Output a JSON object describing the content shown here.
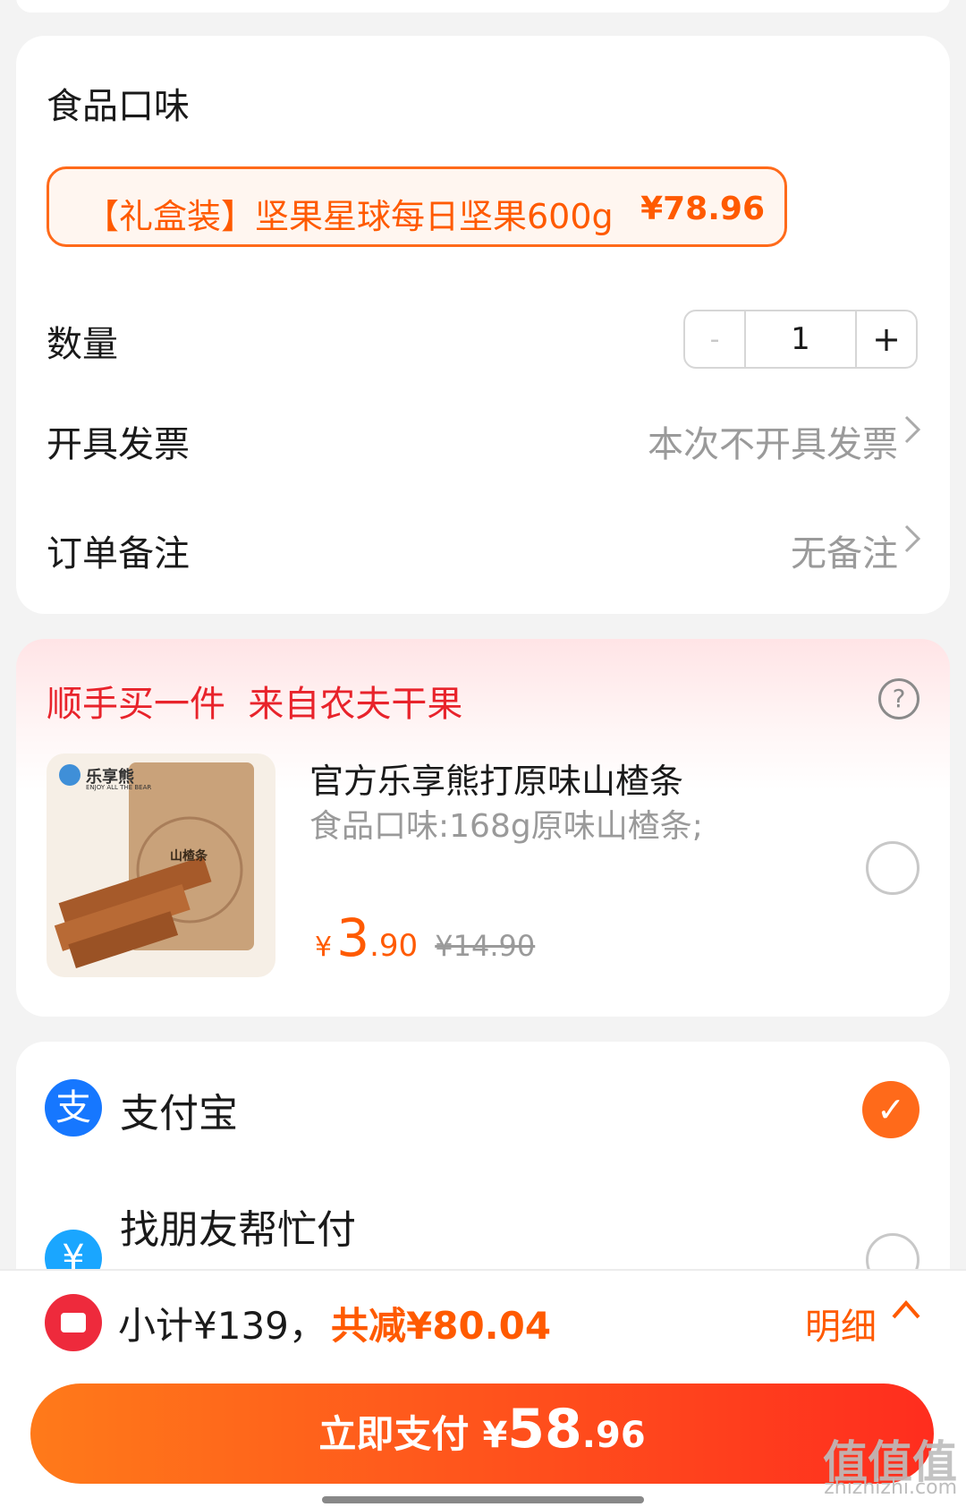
{
  "options": {
    "flavor_label": "食品口味",
    "flavor_option_name": "【礼盒装】坚果星球每日坚果600g",
    "flavor_option_price": "¥78.96",
    "quantity_label": "数量",
    "quantity_minus": "-",
    "quantity_value": "1",
    "quantity_plus": "+",
    "invoice_label": "开具发票",
    "invoice_value": "本次不开具发票",
    "remark_label": "订单备注",
    "remark_value": "无备注"
  },
  "addon": {
    "title": "顺手买一件  来自农夫干果",
    "help": "?",
    "product_name": "官方乐享熊打原味山楂条",
    "product_spec": "食品口味:168g原味山楂条;",
    "price_symbol": "¥",
    "price_int": "3",
    "price_dec": ".90",
    "original_price": "¥14.90",
    "package_brand": "乐享熊",
    "package_sub": "ENJOY ALL THE BEAR",
    "package_label": "山楂条"
  },
  "payment": {
    "alipay_label": "支付宝",
    "alipay_icon": "支",
    "friend_label": "找朋友帮忙付",
    "friend_icon": "¥",
    "check": "✓"
  },
  "summary": {
    "subtotal": "小计¥139，",
    "discount": "共减¥80.04",
    "detail_label": "明细",
    "detail_chevron": "^"
  },
  "pay_button": {
    "label": "立即支付",
    "currency": "¥",
    "amount_int": "58",
    "amount_dec": ".96"
  },
  "watermark": {
    "text": "值值值",
    "sub": "zhizhizhi.com"
  },
  "colors": {
    "accent": "#ff5a00",
    "red": "#e8232b",
    "alipay_blue": "#1677ff"
  },
  "icons": [
    "chevron-right-icon",
    "help-icon",
    "alipay-icon",
    "check-icon",
    "coupon-icon",
    "chevron-up-icon"
  ]
}
